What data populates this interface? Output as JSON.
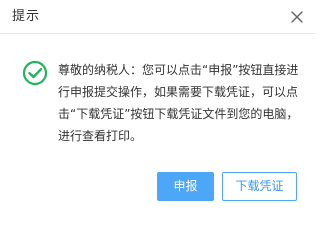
{
  "dialog": {
    "title": "提示",
    "close_icon": "close-icon",
    "status_icon": "success-check-icon",
    "message": "尊敬的纳税人：您可以点击“申报”按钮直接进行申报提交操作，如果需要下载凭证，可以点击“下载凭证”按钮下载凭证文件到您的电脑，进行查看打印。",
    "buttons": {
      "primary_label": "申报",
      "secondary_label": "下载凭证"
    }
  },
  "colors": {
    "accent": "#4da6f6",
    "success": "#21b35f",
    "text": "#333333"
  }
}
